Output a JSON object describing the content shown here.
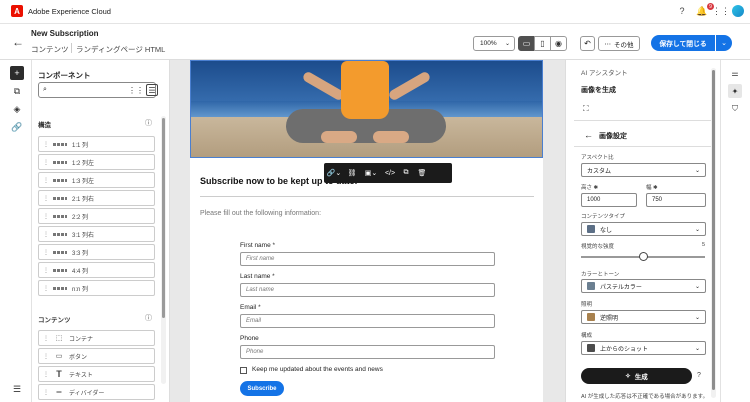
{
  "app": {
    "brand": "Adobe Experience Cloud",
    "logo_letter": "A",
    "notification_count": "9"
  },
  "header": {
    "title": "New Subscription",
    "breadcrumb": [
      "コンテンツ",
      "ランディングページ HTML"
    ],
    "zoom": "100%",
    "more_label": "その他",
    "save_label": "保存して閉じる"
  },
  "components": {
    "title": "コンポーネント",
    "structure_label": "構造",
    "structure": [
      "1:1 列",
      "1:2 列左",
      "1:3 列左",
      "2:1 列右",
      "2:2 列",
      "3:1 列右",
      "3:3 列",
      "4:4 列",
      "n:n 列"
    ],
    "content_label": "コンテンツ",
    "content": [
      "コンテナ",
      "ボタン",
      "テキスト",
      "ディバイダー"
    ]
  },
  "email": {
    "heading": "Subscribe now to be kept up to date!",
    "subtext": "Please fill out the following information:",
    "fields": [
      {
        "label": "First name",
        "required": "*",
        "placeholder": "First name"
      },
      {
        "label": "Last name",
        "required": "*",
        "placeholder": "Last name"
      },
      {
        "label": "Email",
        "required": "*",
        "placeholder": "Email"
      },
      {
        "label": "Phone",
        "required": "",
        "placeholder": "Phone"
      }
    ],
    "checkbox_label": "Keep me updated about the events and news",
    "submit_label": "Subscribe"
  },
  "ai_panel": {
    "section": "AI アシスタント",
    "generate_title": "画像を生成",
    "settings_title": "画像設定",
    "aspect_label": "アスペクト比",
    "aspect_value": "カスタム",
    "width_label": "幅",
    "width_value": "1000",
    "height_label": "高さ",
    "height_value": "750",
    "content_type_label": "コンテンツタイプ",
    "content_type_value": "なし",
    "intensity_label": "視覚的な強度",
    "intensity_value": "5",
    "intensity_fraction": 0.5,
    "color_tone_label": "カラーとトーン",
    "color_tone_value": "パステルカラー",
    "lighting_label": "照明",
    "lighting_value": "逆照明",
    "composition_label": "構成",
    "composition_value": "上からのショット",
    "generate_label": "生成",
    "footnote": "AI が生成した応答は不正確である場合があります。",
    "colors": {
      "none": "#5c6f86",
      "pastel": "#6b7f91",
      "backlight": "#a8814e",
      "top": "#4c4c4c"
    }
  },
  "colors": {
    "accent": "#1473e6",
    "brand": "#eb1000"
  }
}
